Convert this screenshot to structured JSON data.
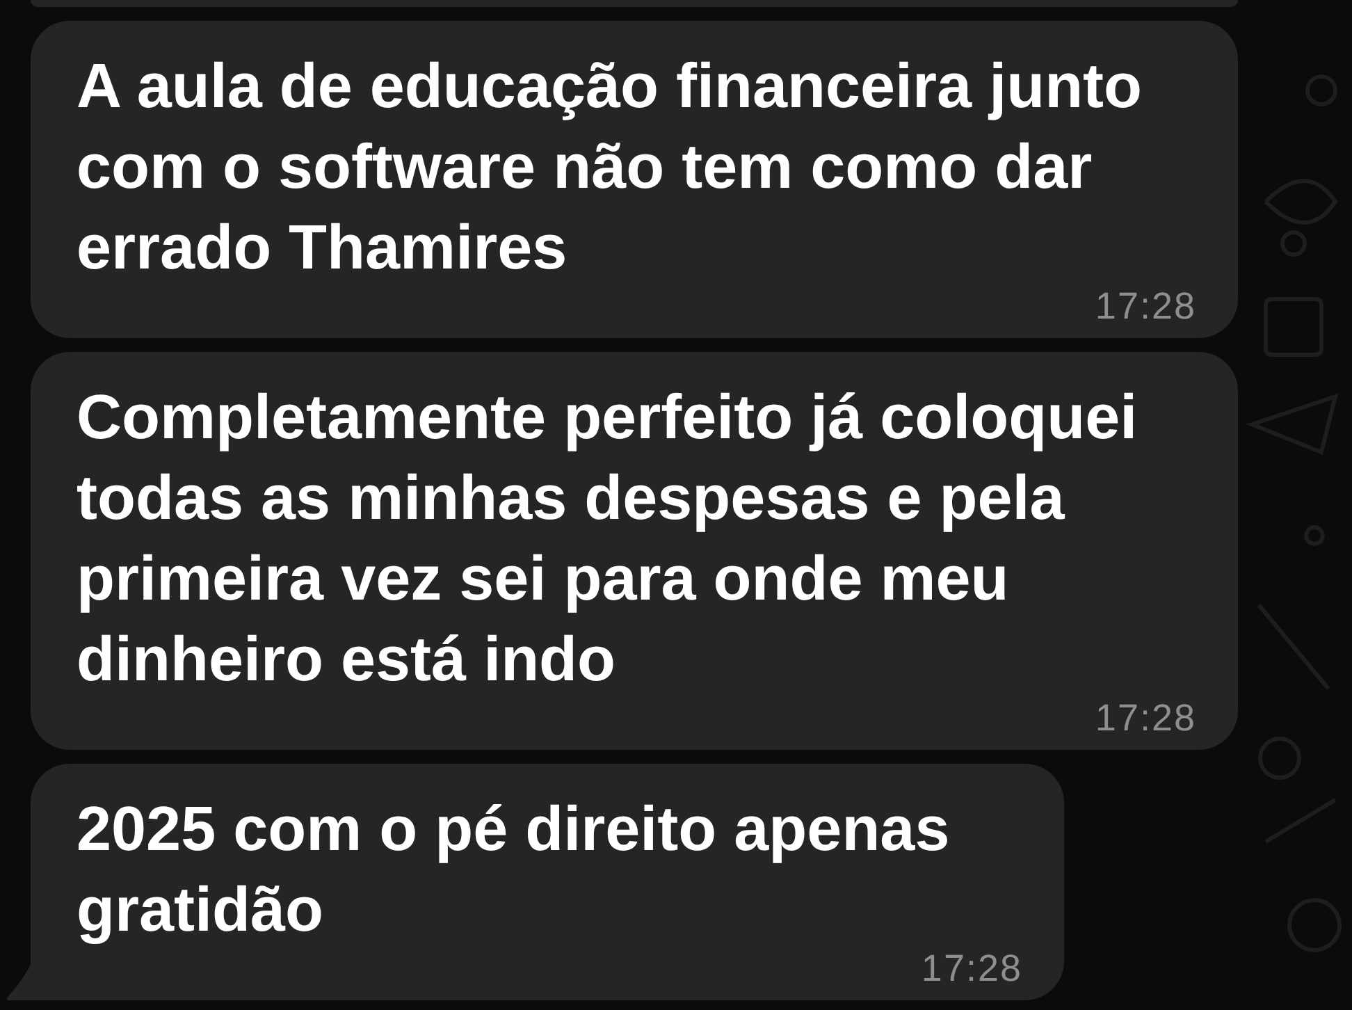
{
  "messages": [
    {
      "text": "A aula de educação financeira junto com o software não tem como dar errado Thamires",
      "time": "17:28",
      "tail": false,
      "wide": true
    },
    {
      "text": "Completamente perfeito já coloquei todas as minhas despesas e pela primeira vez sei para onde meu dinheiro está indo",
      "time": "17:28",
      "tail": false,
      "wide": true
    },
    {
      "text": "2025 com o pé direito apenas gratidão",
      "time": "17:28",
      "tail": true,
      "wide": false
    }
  ]
}
